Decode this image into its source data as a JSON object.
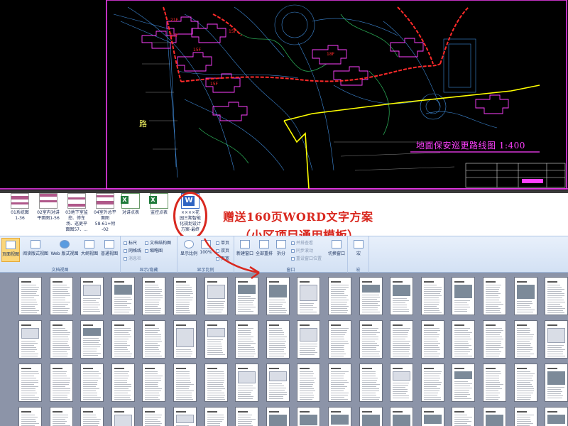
{
  "cad": {
    "drawing_title": "地面保安巡更路线图",
    "drawing_scale": "1:400",
    "road_label": "路",
    "colors": {
      "background": "#000000",
      "route": "#ff2a2a",
      "boundary": "#ffff00",
      "buildings": "#ff40ff",
      "linework": "#4aa3ff"
    },
    "building_labels": [
      "15F",
      "15F",
      "15F",
      "15F",
      "18F",
      "21F"
    ]
  },
  "file_browser": {
    "items": [
      {
        "label": "01系统图\n1-36",
        "icon": "cad-thumbnail-icon"
      },
      {
        "label": "02室内对讲\n平面图1-56",
        "icon": "cad-thumbnail-icon"
      },
      {
        "label": "03地下室监\n控、停车\n场、巡更平\n面图57、...",
        "icon": "cad-thumbnail-icon"
      },
      {
        "label": "04室外总平\n面图\n58-61+附\n-02",
        "icon": "cad-thumbnail-icon"
      },
      {
        "label": "对讲点表",
        "icon": "excel-icon"
      },
      {
        "label": "监控点表",
        "icon": "excel-icon"
      },
      {
        "label": "××××花\n园三期智能\n化规划设计\n方案-最终",
        "icon": "word-icon"
      }
    ]
  },
  "promo": {
    "line1": "赠送160页WORD文字方案",
    "line2": "（小区项目通用模板）",
    "accent": "#d9281f"
  },
  "ribbon": {
    "groups": {
      "views": "文档视图",
      "show_hide": "显示/隐藏",
      "zoom": "显示比例",
      "window": "窗口",
      "macro": "宏"
    },
    "view_buttons": [
      "页面视图",
      "阅读版式视图",
      "Web 版式视图",
      "大纲视图",
      "普通视图"
    ],
    "show_items": [
      "标尺",
      "网格线",
      "消息栏",
      "文档结构图",
      "缩略图"
    ],
    "zoom_buttons": [
      "显示比例",
      "100%"
    ],
    "zoom_small": [
      "单页",
      "双页",
      "页宽"
    ],
    "window_buttons": [
      "新建窗口",
      "全部重排",
      "拆分"
    ],
    "window_small": [
      "并排查看",
      "同步滚动",
      "重设窗口位置"
    ],
    "switch_window": "切换窗口",
    "macro_button": "宏"
  }
}
